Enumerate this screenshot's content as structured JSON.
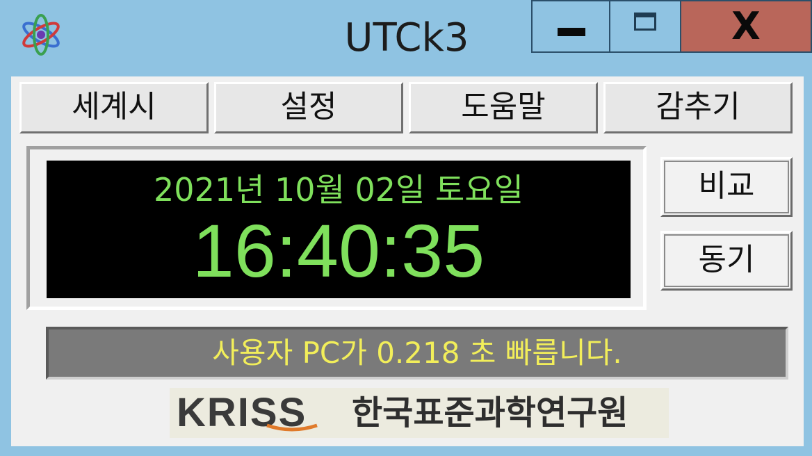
{
  "window": {
    "title": "UTCk3",
    "minimize_icon": "minimize-icon",
    "maximize_icon": "maximize-icon",
    "close_label": "X"
  },
  "tabs": [
    {
      "label": "세계시"
    },
    {
      "label": "설정"
    },
    {
      "label": "도움말"
    },
    {
      "label": "감추기"
    }
  ],
  "clock": {
    "date": "2021년 10월 02일 토요일",
    "time": "16:40:35",
    "color": "#7fe05c"
  },
  "side_buttons": {
    "compare": "비교",
    "sync": "동기"
  },
  "status": {
    "message": "사용자 PC가 0.218 초 빠릅니다.",
    "text_color": "#f2ee5a"
  },
  "logo": {
    "brand": "KRISS",
    "org_name": "한국표준과학연구원"
  },
  "colors": {
    "titlebar": "#8fc3e2",
    "close_button": "#b9665a",
    "clock_bg": "#000000"
  }
}
